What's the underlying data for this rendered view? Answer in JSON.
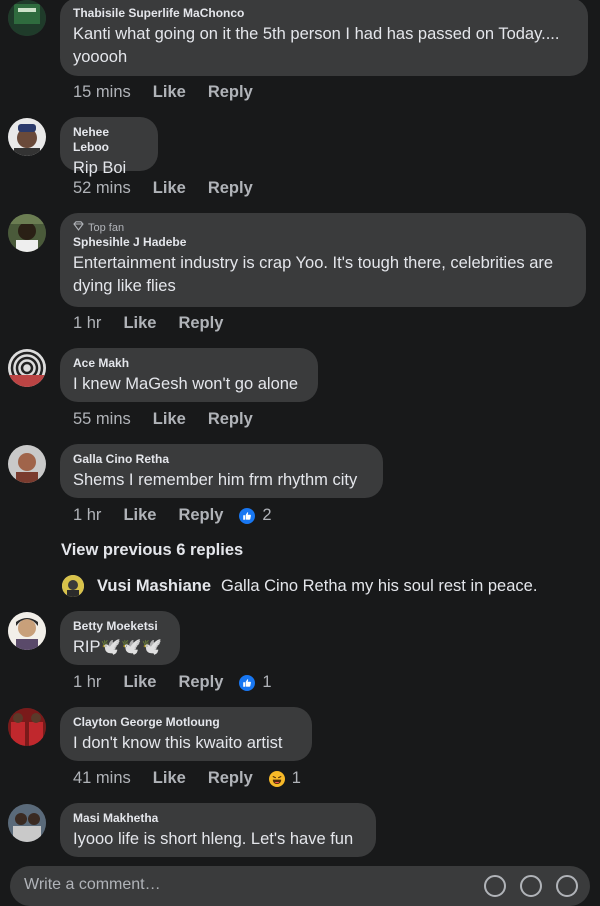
{
  "comments": [
    {
      "author": "Thabisile Superlife MaChonco",
      "text": "Kanti what going on it the 5th person I had has passed on Today.... yooooh",
      "time": "15 mins",
      "like": "Like",
      "reply": "Reply"
    },
    {
      "author": "Nehee Leboo",
      "text": "Rip Boi",
      "time": "52 mins",
      "like": "Like",
      "reply": "Reply"
    },
    {
      "badge": "Top fan",
      "author": "Sphesihle J Hadebe",
      "text": "Entertainment industry is crap Yoo. It's tough there, celebrities are dying like flies",
      "time": "1 hr",
      "like": "Like",
      "reply": "Reply"
    },
    {
      "author": "Ace Makh",
      "text": "I knew MaGesh won't go alone",
      "time": "55 mins",
      "like": "Like",
      "reply": "Reply"
    },
    {
      "author": "Galla Cino Retha",
      "text": "Shems I remember him frm rhythm city",
      "time": "1 hr",
      "like": "Like",
      "reply": "Reply",
      "reaction_count": "2"
    },
    {
      "author": "Betty Moeketsi",
      "text": "RIP🕊️🕊️🕊️",
      "time": "1 hr",
      "like": "Like",
      "reply": "Reply",
      "reaction_count": "1"
    },
    {
      "author": "Clayton George Motloung",
      "text": "I don't know this kwaito artist",
      "time": "41 mins",
      "like": "Like",
      "reply": "Reply",
      "reaction_count": "1"
    },
    {
      "author": "Masi Makhetha",
      "text": "Iyooo life is short hleng. Let's have fun"
    }
  ],
  "view_previous": "View previous 6 replies",
  "reply_preview": {
    "author": "Vusi Mashiane",
    "text": "Galla Cino Retha my his soul rest in peace."
  },
  "write_placeholder": "Write a comment…",
  "colors": {
    "background": "#18191a",
    "bubble": "#3a3b3c",
    "like_blue": "#1877f2",
    "haha_yellow": "#f7b928"
  }
}
